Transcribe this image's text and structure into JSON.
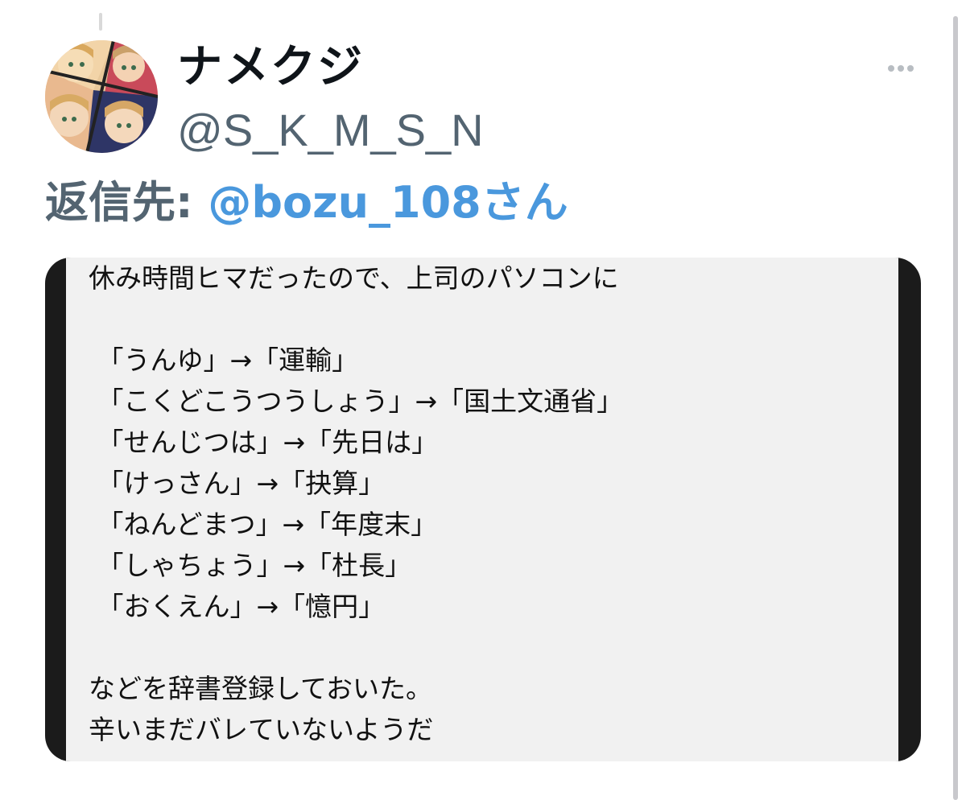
{
  "tweet": {
    "display_name": "ナメクジ",
    "handle": "@S_K_M_S_N",
    "reply_label": "返信先: ",
    "reply_target": "@bozu_108さん",
    "more_icon": "more-horizontal-icon",
    "avatar": "profile-avatar",
    "media_text_lines": [
      "休み時間ヒマだったので、上司のパソコンに",
      "",
      " 「うんゆ」→「運輸」",
      " 「こくどこうつうしょう」→「国土文通省」",
      " 「せんじつは」→「先日は」",
      " 「けっさん」→「抉算」",
      " 「ねんどまつ」→「年度末」",
      " 「しゃちょう」→「杜長」",
      " 「おくえん」→「憶円」",
      "",
      "などを辞書登録しておいた。",
      "辛いまだバレていないようだ"
    ]
  },
  "colors": {
    "name": "#0f1419",
    "secondary": "#536471",
    "link": "#4a98dd",
    "media_bg": "#f1f1f1",
    "media_frame": "#1b1b1b"
  }
}
